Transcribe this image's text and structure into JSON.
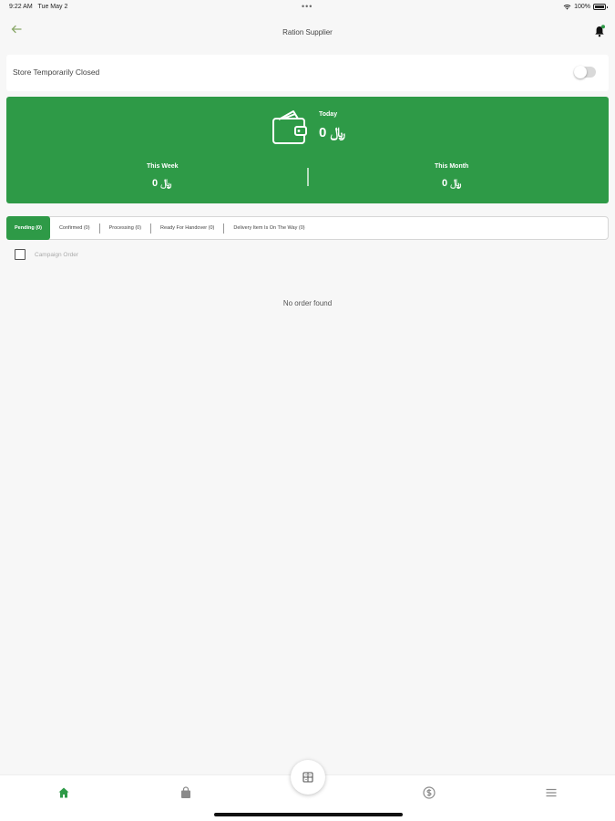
{
  "status_bar": {
    "time": "9:22 AM",
    "date": "Tue May 2",
    "battery": "100%"
  },
  "header": {
    "title": "Ration Supplier"
  },
  "store": {
    "label": "Store Temporarily Closed",
    "toggle_on": false
  },
  "earnings": {
    "today_label": "Today",
    "today_value": "0 ﷼",
    "week_label": "This Week",
    "week_value": "0 ﷼",
    "month_label": "This Month",
    "month_value": "0 ﷼"
  },
  "tabs": [
    {
      "label": "Pending (0)",
      "active": true
    },
    {
      "label": "Confirmed (0)",
      "active": false
    },
    {
      "label": "Processing (0)",
      "active": false
    },
    {
      "label": "Ready For Handover (0)",
      "active": false
    },
    {
      "label": "Delivery Item Is On The Way (0)",
      "active": false
    }
  ],
  "campaign": {
    "label": "Campaign Order",
    "checked": false
  },
  "empty_message": "No order found",
  "bottom_nav": [
    {
      "icon": "home-icon",
      "active": true
    },
    {
      "icon": "orders-bag-icon",
      "active": false
    },
    {
      "icon": "scan-icon",
      "active": false
    },
    {
      "icon": "earnings-icon",
      "active": false
    },
    {
      "icon": "menu-icon",
      "active": false
    }
  ],
  "colors": {
    "brand": "#2e9a47",
    "background": "#f7f7f7",
    "inactive_icon": "#8a8a8a"
  }
}
